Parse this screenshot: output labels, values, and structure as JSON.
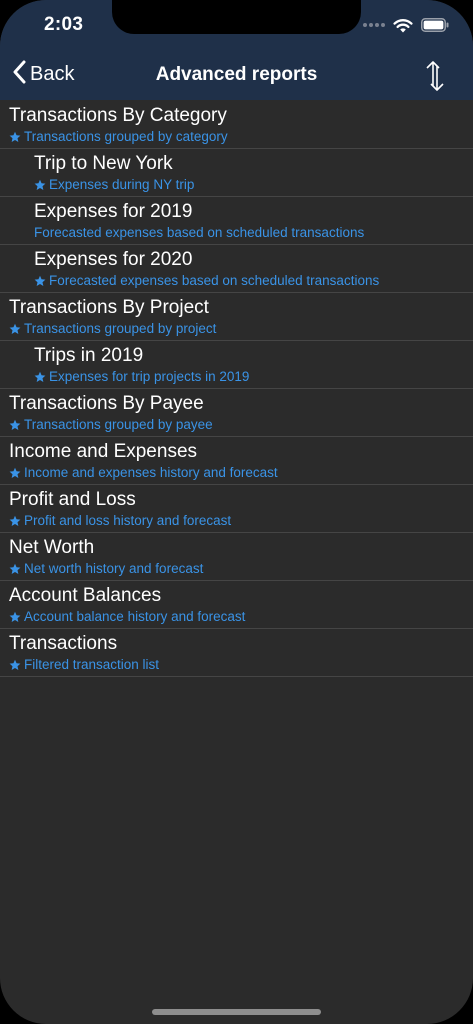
{
  "status_bar": {
    "time": "2:03",
    "icons": [
      "signal-dots-icon",
      "wifi-icon",
      "battery-icon"
    ]
  },
  "nav": {
    "back_label": "Back",
    "title": "Advanced reports",
    "sort_icon": "sort-arrows-icon"
  },
  "colors": {
    "nav_background": "#1f3049",
    "list_background": "#2b2b2b",
    "subtitle_accent": "#3a93e6",
    "separator": "#454545"
  },
  "reports": [
    {
      "level": 0,
      "starred": true,
      "title": "Transactions By Category",
      "subtitle": "Transactions grouped by category"
    },
    {
      "level": 1,
      "starred": true,
      "title": "Trip to New York",
      "subtitle": "Expenses during NY trip"
    },
    {
      "level": 1,
      "starred": false,
      "title": "Expenses for 2019",
      "subtitle": "Forecasted expenses based on scheduled transactions"
    },
    {
      "level": 1,
      "starred": true,
      "title": "Expenses for 2020",
      "subtitle": "Forecasted expenses based on scheduled transactions"
    },
    {
      "level": 0,
      "starred": true,
      "title": "Transactions By Project",
      "subtitle": "Transactions grouped by project"
    },
    {
      "level": 1,
      "starred": true,
      "title": "Trips in 2019",
      "subtitle": "Expenses for trip projects in 2019"
    },
    {
      "level": 0,
      "starred": true,
      "title": "Transactions By Payee",
      "subtitle": "Transactions grouped by payee"
    },
    {
      "level": 0,
      "starred": true,
      "title": "Income and Expenses",
      "subtitle": "Income and expenses history and forecast"
    },
    {
      "level": 0,
      "starred": true,
      "title": "Profit and Loss",
      "subtitle": "Profit and loss history and forecast"
    },
    {
      "level": 0,
      "starred": true,
      "title": "Net Worth",
      "subtitle": "Net worth history and forecast"
    },
    {
      "level": 0,
      "starred": true,
      "title": "Account Balances",
      "subtitle": "Account balance history and forecast"
    },
    {
      "level": 0,
      "starred": true,
      "title": "Transactions",
      "subtitle": "Filtered transaction list"
    }
  ]
}
